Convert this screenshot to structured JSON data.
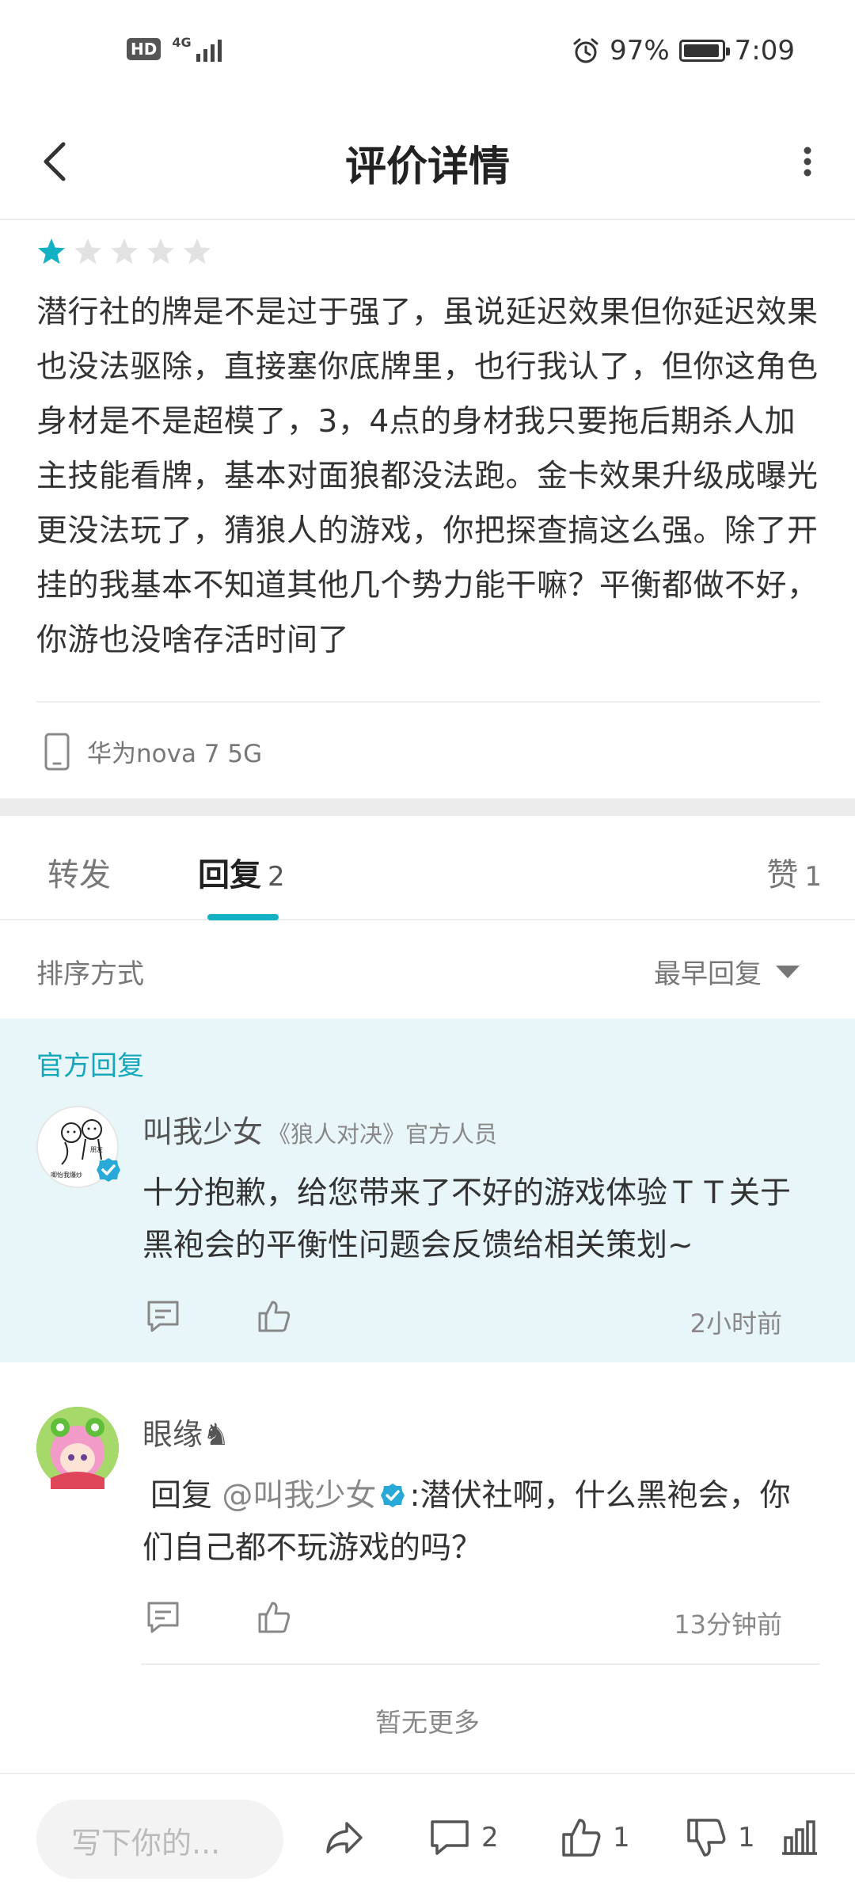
{
  "status_bar": {
    "hd": "HD",
    "network": "4G",
    "battery_pct": "97%",
    "time": "7:09",
    "battery_level": 0.97
  },
  "header": {
    "title": "评价详情"
  },
  "review": {
    "rating": 1,
    "rating_max": 5,
    "text": "潜行社的牌是不是过于强了，虽说延迟效果但你延迟效果也没法驱除，直接塞你底牌里，也行我认了，但你这角色身材是不是超模了，3，4点的身材我只要拖后期杀人加主技能看牌，基本对面狼都没法跑。金卡效果升级成曝光更没法玩了，猜狼人的游戏，你把探查搞这么强。除了开挂的我基本不知道其他几个势力能干嘛？平衡都做不好，你游也没啥存活时间了",
    "device": "华为nova 7 5G"
  },
  "tabs": [
    {
      "label": "转发",
      "count": ""
    },
    {
      "label": "回复",
      "count": "2"
    },
    {
      "label": "赞",
      "count": "1"
    }
  ],
  "sort": {
    "label": "排序方式",
    "value": "最早回复"
  },
  "official_reply": {
    "section_label": "官方回复",
    "name": "叫我少女",
    "role": "《狼人对决》官方人员",
    "text": "十分抱歉，给您带来了不好的游戏体验ＴＴ关于黑袍会的平衡性问题会反馈给相关策划~",
    "time": "2小时前",
    "avatar_text_1": "朋友",
    "avatar_text_2": "唧怡我爆炒"
  },
  "reply": {
    "name": "眼缘♞",
    "prefix": "回复",
    "mention": "@叫我少女",
    "text": ":潜伏社啊，什么黑袍会，你们自己都不玩游戏的吗？",
    "time": "13分钟前"
  },
  "footer": {
    "no_more": "暂无更多"
  },
  "bottom_bar": {
    "compose_placeholder": "写下你的...",
    "comment_count": "2",
    "like_count": "1",
    "dislike_count": "1"
  },
  "colors": {
    "accent": "#14b0c4",
    "official_bg": "#e8f6f9",
    "star_on": "#14b0c4",
    "star_off": "#e2e2e2"
  }
}
